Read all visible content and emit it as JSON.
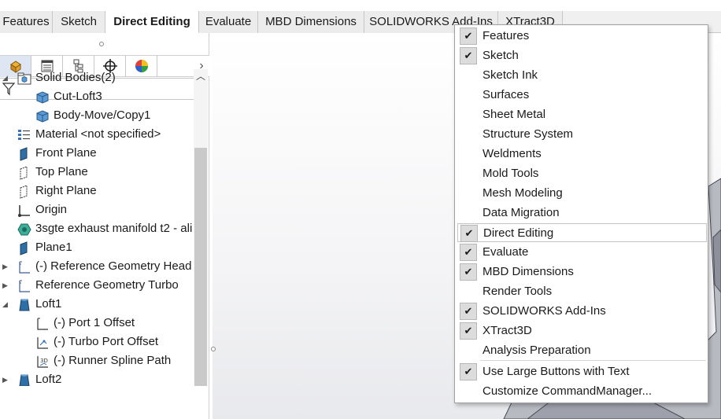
{
  "command_tabs": [
    {
      "label": "Features",
      "active": false
    },
    {
      "label": "Sketch",
      "active": false
    },
    {
      "label": "Direct Editing",
      "active": true
    },
    {
      "label": "Evaluate",
      "active": false
    },
    {
      "label": "MBD Dimensions",
      "active": false
    },
    {
      "label": "SOLIDWORKS Add-Ins",
      "active": false
    },
    {
      "label": "XTract3D",
      "active": false
    }
  ],
  "panel_tabs": [
    {
      "icon": "featuremanager-icon"
    },
    {
      "icon": "propertymanager-icon"
    },
    {
      "icon": "configurationmanager-icon"
    },
    {
      "icon": "dimxpertmanager-icon"
    },
    {
      "icon": "displaymanager-icon"
    }
  ],
  "panel_more": "›",
  "tree": [
    {
      "label": "Solid Bodies(2)",
      "icon": "solid-bodies-folder-icon",
      "expander": "collapse"
    },
    {
      "label": "Cut-Loft3",
      "icon": "solid-body-icon",
      "expander": ""
    },
    {
      "label": "Body-Move/Copy1",
      "icon": "solid-body-icon",
      "expander": ""
    },
    {
      "label": "Material <not specified>",
      "icon": "material-icon",
      "expander": ""
    },
    {
      "label": "Front Plane",
      "icon": "plane-icon",
      "expander": ""
    },
    {
      "label": "Top Plane",
      "icon": "plane-icon",
      "expander": ""
    },
    {
      "label": "Right Plane",
      "icon": "plane-icon",
      "expander": ""
    },
    {
      "label": "Origin",
      "icon": "origin-icon",
      "expander": ""
    },
    {
      "label": "3sgte exhaust manifold t2 - ali",
      "icon": "part-icon",
      "expander": ""
    },
    {
      "label": "Plane1",
      "icon": "plane-icon",
      "expander": ""
    },
    {
      "label": "(-) Reference Geometry Head",
      "icon": "sketch-icon",
      "expander": "expand"
    },
    {
      "label": "Reference Geometry Turbo",
      "icon": "sketch-icon",
      "expander": "expand"
    },
    {
      "label": "Loft1",
      "icon": "loft-icon",
      "expander": "collapse"
    },
    {
      "label": "(-) Port 1 Offset",
      "icon": "sketch-icon",
      "expander": ""
    },
    {
      "label": "(-) Turbo Port Offset",
      "icon": "sketch-icon",
      "expander": ""
    },
    {
      "label": "(-) Runner Spline Path",
      "icon": "3d-sketch-icon",
      "expander": ""
    },
    {
      "label": "Loft2",
      "icon": "loft-icon",
      "expander": "expand"
    }
  ],
  "menu": {
    "items": [
      {
        "label": "Features",
        "checked": true
      },
      {
        "label": "Sketch",
        "checked": true
      },
      {
        "label": "Sketch Ink",
        "checked": false
      },
      {
        "label": "Surfaces",
        "checked": false
      },
      {
        "label": "Sheet Metal",
        "checked": false
      },
      {
        "label": "Structure System",
        "checked": false
      },
      {
        "label": "Weldments",
        "checked": false
      },
      {
        "label": "Mold Tools",
        "checked": false
      },
      {
        "label": "Mesh Modeling",
        "checked": false
      },
      {
        "label": "Data Migration",
        "checked": false
      },
      {
        "label": "Direct Editing",
        "checked": true
      },
      {
        "label": "Evaluate",
        "checked": true
      },
      {
        "label": "MBD Dimensions",
        "checked": true
      },
      {
        "label": "Render Tools",
        "checked": false
      },
      {
        "label": "SOLIDWORKS Add-Ins",
        "checked": true
      },
      {
        "label": "XTract3D",
        "checked": true
      },
      {
        "label": "Analysis Preparation",
        "checked": false
      }
    ],
    "options": [
      {
        "label": "Use Large Buttons with Text",
        "checked": true
      },
      {
        "label": "Customize CommandManager...",
        "checked": false
      }
    ],
    "check_glyph": "✔"
  },
  "colors": {
    "accent_selected": "#dde6f2",
    "body_icon": "#5b9bd5",
    "plane_icon": "#2f6fa8",
    "check_bg": "#dcdcdc"
  }
}
